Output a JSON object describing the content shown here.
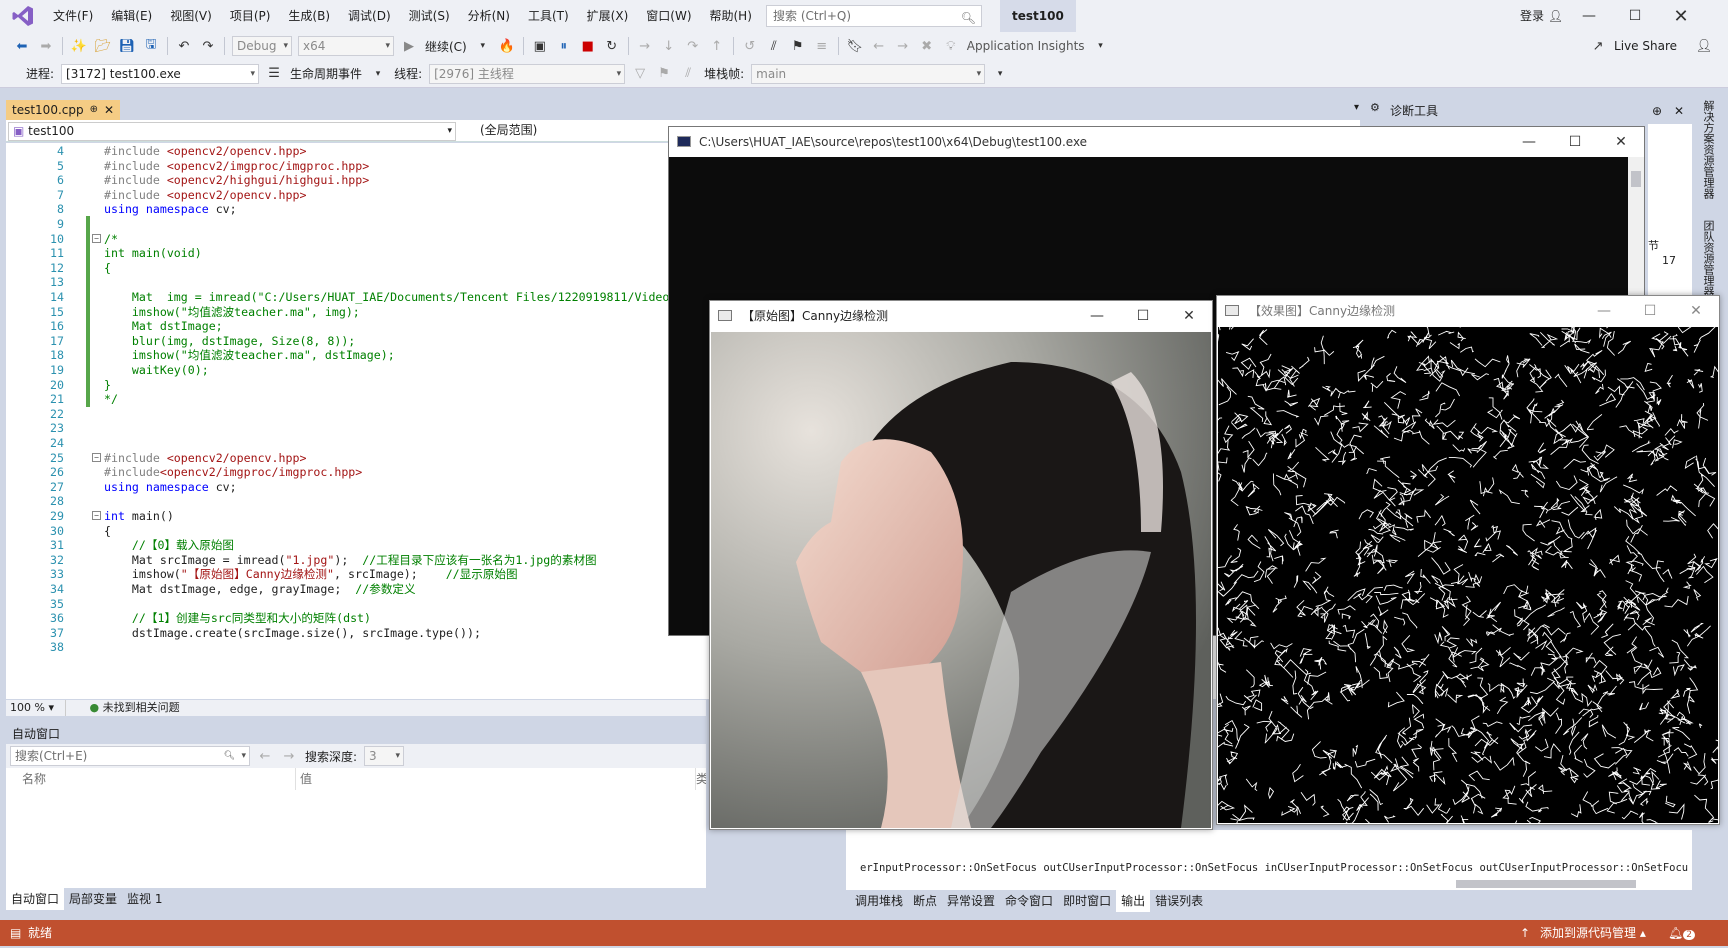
{
  "app": {
    "menu": [
      "文件(F)",
      "编辑(E)",
      "视图(V)",
      "项目(P)",
      "生成(B)",
      "调试(D)",
      "测试(S)",
      "分析(N)",
      "工具(T)",
      "扩展(X)",
      "窗口(W)",
      "帮助(H)"
    ],
    "search_placeholder": "搜索 (Ctrl+Q)",
    "solution_name": "test100",
    "login": "登录"
  },
  "toolbar1": {
    "config": "Debug",
    "platform": "x64",
    "continue": "继续(C)",
    "app_insights": "Application Insights",
    "live_share": "Live Share"
  },
  "toolbar2": {
    "process_label": "进程:",
    "process_value": "[3172] test100.exe",
    "lifecycle": "生命周期事件",
    "thread_label": "线程:",
    "thread_value": "[2976] 主线程",
    "stack_label": "堆栈帧:",
    "stack_value": "main"
  },
  "editor": {
    "tab_name": "test100.cpp",
    "scope": "test100",
    "global_scope": "(全局范围)",
    "zoom": "100 %",
    "issues": "未找到相关问题",
    "lines": [
      {
        "n": "4",
        "t": "#include <opencv2/opencv.hpp>"
      },
      {
        "n": "5",
        "t": "#include <opencv2/imgproc/imgproc.hpp>"
      },
      {
        "n": "6",
        "t": "#include <opencv2/highgui/highgui.hpp>"
      },
      {
        "n": "7",
        "t": "#include <opencv2/opencv.hpp>"
      },
      {
        "n": "8",
        "t": "using namespace cv;"
      },
      {
        "n": "9",
        "t": ""
      },
      {
        "n": "10",
        "t": "/*"
      },
      {
        "n": "11",
        "t": "int main(void)"
      },
      {
        "n": "12",
        "t": "{"
      },
      {
        "n": "13",
        "t": ""
      },
      {
        "n": "14",
        "t": "    Mat  img = imread(\"C:/Users/HUAT_IAE/Documents/Tencent Files/1220919811/Video/"
      },
      {
        "n": "15",
        "t": "    imshow(\"均值滤波teacher.ma\", img);"
      },
      {
        "n": "16",
        "t": "    Mat dstImage;"
      },
      {
        "n": "17",
        "t": "    blur(img, dstImage, Size(8, 8));"
      },
      {
        "n": "18",
        "t": "    imshow(\"均值滤波teacher.ma\", dstImage);"
      },
      {
        "n": "19",
        "t": "    waitKey(0);"
      },
      {
        "n": "20",
        "t": "}"
      },
      {
        "n": "21",
        "t": "*/"
      },
      {
        "n": "22",
        "t": ""
      },
      {
        "n": "23",
        "t": ""
      },
      {
        "n": "24",
        "t": ""
      },
      {
        "n": "25",
        "t": "#include <opencv2/opencv.hpp>"
      },
      {
        "n": "26",
        "t": "#include<opencv2/imgproc/imgproc.hpp>"
      },
      {
        "n": "27",
        "t": "using namespace cv;"
      },
      {
        "n": "28",
        "t": ""
      },
      {
        "n": "29",
        "t": "int main()"
      },
      {
        "n": "30",
        "t": "{"
      },
      {
        "n": "31",
        "t": "    //【0】载入原始图"
      },
      {
        "n": "32",
        "t": "    Mat srcImage = imread(\"1.jpg\");  //工程目录下应该有一张名为1.jpg的素材图"
      },
      {
        "n": "33",
        "t": "    imshow(\"【原始图】Canny边缘检测\", srcImage);    //显示原始图"
      },
      {
        "n": "34",
        "t": "    Mat dstImage, edge, grayImage;  //参数定义"
      },
      {
        "n": "35",
        "t": ""
      },
      {
        "n": "36",
        "t": "    //【1】创建与src同类型和大小的矩阵(dst)"
      },
      {
        "n": "37",
        "t": "    dstImage.create(srcImage.size(), srcImage.type());"
      },
      {
        "n": "38",
        "t": ""
      }
    ]
  },
  "autos": {
    "title": "自动窗口",
    "search_placeholder": "搜索(Ctrl+E)",
    "depth_label": "搜索深度:",
    "depth_value": "3",
    "columns": [
      "名称",
      "值",
      "类"
    ],
    "tabs": [
      "自动窗口",
      "局部变量",
      "监视 1"
    ]
  },
  "diag": {
    "title": "诊断工具",
    "clipped_label": "节",
    "clipped_value": "17"
  },
  "right_vertical_tabs": [
    "解决方案资源管理器",
    "团队资源管理器"
  ],
  "output": {
    "text": "erInputProcessor::OnSetFocus outCUserInputProcessor::OnSetFocus inCUserInputProcessor::OnSetFocus outCUserInputProcessor::OnSetFocus in",
    "tabs": [
      "调用堆栈",
      "断点",
      "异常设置",
      "命令窗口",
      "即时窗口",
      "输出",
      "错误列表"
    ]
  },
  "status": {
    "left": "就绪",
    "right": "添加到源代码管理",
    "notif_count": "2"
  },
  "console": {
    "title": "C:\\Users\\HUAT_IAE\\source\\repos\\test100\\x64\\Debug\\test100.exe"
  },
  "orig_window": {
    "title": "【原始图】Canny边缘检测"
  },
  "effect_window": {
    "title": "【效果图】Canny边缘检测"
  }
}
